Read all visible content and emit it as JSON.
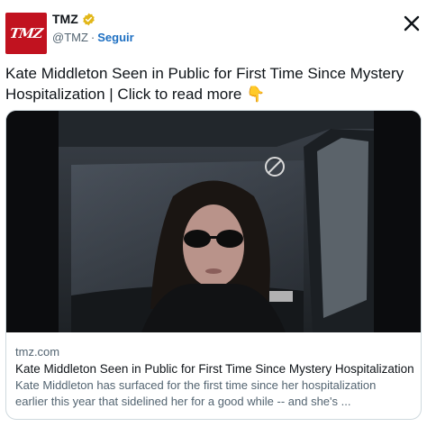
{
  "account": {
    "display_name": "TMZ",
    "handle": "@TMZ",
    "separator": "·",
    "follow_label": "Seguir",
    "avatar_text": "TMZ"
  },
  "tweet": {
    "line1": "Kate Middleton Seen in Public for First Time Since Mystery",
    "line2": "Hospitalization  | Click to read more 👇"
  },
  "card": {
    "domain": "tmz.com",
    "title": "Kate Middleton Seen in Public for First Time Since Mystery Hospitalization",
    "desc_line1": "Kate Middleton has surfaced for the first time since her hospitalization",
    "desc_line2": "earlier this year that sidelined her for a good while -- and she's ..."
  },
  "icons": {
    "verified": "verified-badge-icon",
    "close": "close-icon"
  },
  "colors": {
    "brand": "#c1121f",
    "verified": "#e2b719",
    "link": "#1d6fc2",
    "muted": "#536471"
  }
}
